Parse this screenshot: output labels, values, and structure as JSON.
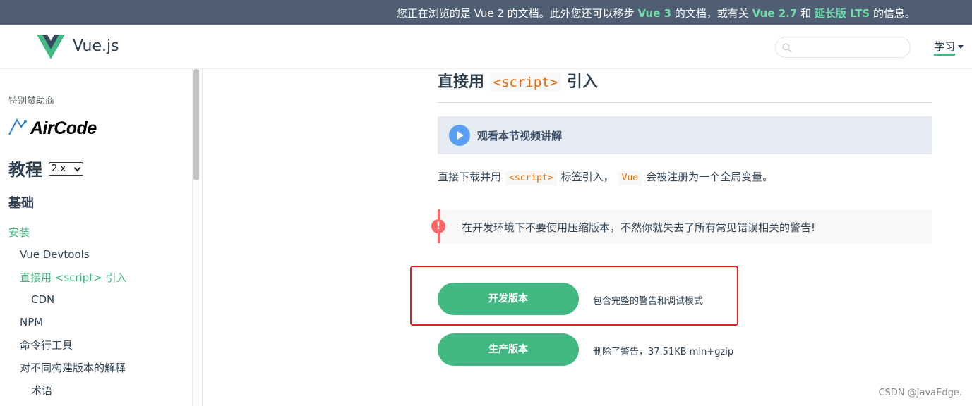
{
  "banner": {
    "prefix": "您正在浏览的是 Vue 2 的文档。此外您还可以移步 ",
    "link_vue3": "Vue 3",
    "mid": " 的文档，或有关 ",
    "link_vue27": "Vue 2.7",
    "and": " 和 ",
    "link_lts": "延长版 LTS",
    "suffix": " 的信息。"
  },
  "header": {
    "logo_text": "Vue.js",
    "search_placeholder": "",
    "learn_label": "学习"
  },
  "sidebar": {
    "sponsor_label": "特别赞助商",
    "sponsor_name": "AirCode",
    "tutorial_title": "教程",
    "version_selected": "2.x",
    "section_title": "基础",
    "items": [
      {
        "label": "安装"
      },
      {
        "label": "Vue Devtools"
      },
      {
        "label": "直接用 <script> 引入"
      },
      {
        "label": "CDN"
      },
      {
        "label": "NPM"
      },
      {
        "label": "命令行工具"
      },
      {
        "label": "对不同构建版本的解释"
      },
      {
        "label": "术语"
      }
    ]
  },
  "main": {
    "heading_prefix": "直接用 ",
    "heading_code": "<script>",
    "heading_suffix": " 引入",
    "video_label": "观看本节视频讲解",
    "para_prefix": "直接下载并用",
    "para_code1": "<script>",
    "para_mid": "标签引入，",
    "para_code2": "Vue",
    "para_suffix": "会被注册为一个全局变量。",
    "warning_text": "在开发环境下不要使用压缩版本，不然你就失去了所有常见错误相关的警告!",
    "buttons": [
      {
        "label": "开发版本",
        "desc": "包含完整的警告和调试模式"
      },
      {
        "label": "生产版本",
        "desc": "删除了警告，37.51KB min+gzip"
      }
    ]
  },
  "watermark": "CSDN @JavaEdge.",
  "colors": {
    "accent": "#42b983",
    "banner_bg": "#4f5e72",
    "warning": "#ff6666",
    "highlight_box": "#e02020"
  }
}
